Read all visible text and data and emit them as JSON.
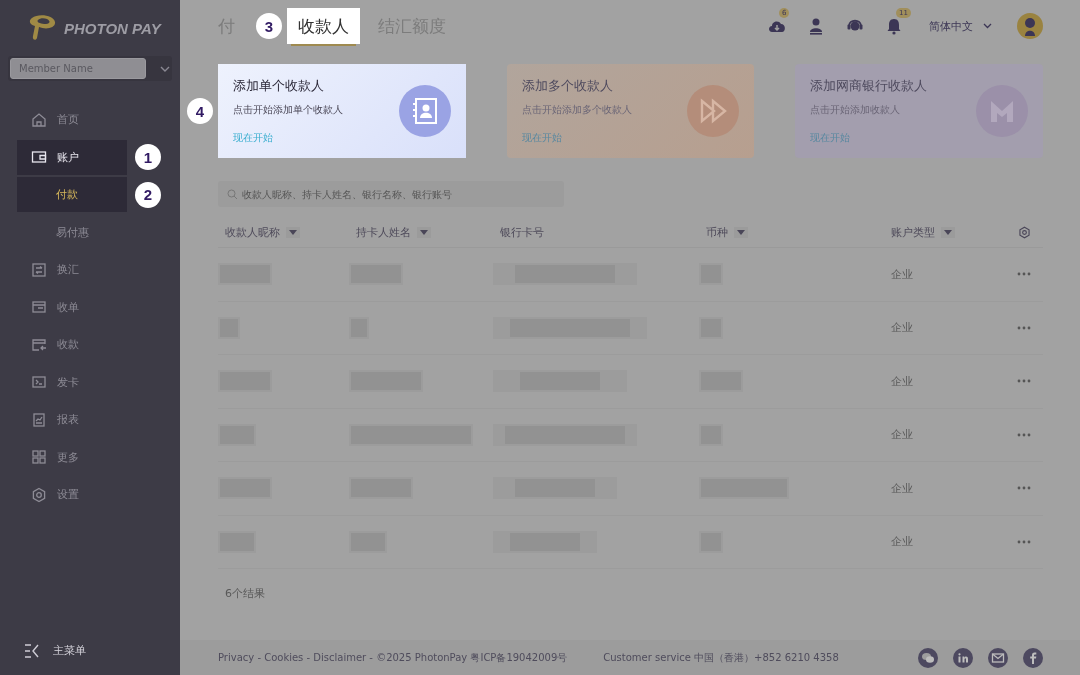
{
  "logo": {
    "text": "PHOTON PAY"
  },
  "member_select": {
    "placeholder": "Member Name"
  },
  "nav": [
    {
      "label": "首页",
      "kind": "home",
      "highlighted": false
    },
    {
      "label": "账户",
      "kind": "wallet",
      "highlighted": true,
      "callout": "1",
      "children": [
        {
          "label": "付款",
          "selected": true,
          "highlighted": true,
          "callout": "2"
        },
        {
          "label": "易付惠",
          "selected": false,
          "highlighted": false
        }
      ]
    },
    {
      "label": "换汇",
      "kind": "exchange",
      "highlighted": false
    },
    {
      "label": "收单",
      "kind": "acquiring",
      "highlighted": false
    },
    {
      "label": "收款",
      "kind": "receive",
      "highlighted": false
    },
    {
      "label": "发卡",
      "kind": "card",
      "highlighted": false
    },
    {
      "label": "报表",
      "kind": "report",
      "highlighted": false
    },
    {
      "label": "更多",
      "kind": "grid",
      "highlighted": false
    },
    {
      "label": "设置",
      "kind": "gear",
      "highlighted": false
    }
  ],
  "collapse_menu": {
    "label": "主菜单"
  },
  "tabs": [
    {
      "label": "付",
      "selected": false
    },
    {
      "label": "收款人",
      "selected": true,
      "callout": "3"
    },
    {
      "label": "结汇额度",
      "selected": false
    }
  ],
  "header": {
    "icons": [
      {
        "kind": "download",
        "badge": "6"
      },
      {
        "kind": "user"
      },
      {
        "kind": "support"
      },
      {
        "kind": "bell",
        "badge": "11"
      }
    ],
    "language": "简体中文"
  },
  "cards": [
    {
      "kind": "single",
      "title": "添加单个收款人",
      "description": "点击开始添加单个收款人",
      "link": "现在开始",
      "highlighted": true,
      "callout": "4"
    },
    {
      "kind": "bulk",
      "title": "添加多个收款人",
      "description": "点击开始添加多个收款人",
      "link": "现在开始",
      "highlighted": false
    },
    {
      "kind": "mybank",
      "title": "添加网商银行收款人",
      "description": "点击开始添加收款人",
      "link": "现在开始",
      "highlighted": false
    }
  ],
  "search": {
    "placeholder": "收款人昵称、持卡人姓名、银行名称、银行账号"
  },
  "table": {
    "columns": [
      {
        "label": "收款人昵称",
        "sortable": true
      },
      {
        "label": "持卡人姓名",
        "sortable": true
      },
      {
        "label": "银行卡号",
        "sortable": false
      },
      {
        "label": "币种",
        "sortable": true
      },
      {
        "label": "账户类型",
        "sortable": true
      }
    ],
    "rows": [
      {
        "account_type": "企业"
      },
      {
        "account_type": "企业"
      },
      {
        "account_type": "企业"
      },
      {
        "account_type": "企业"
      },
      {
        "account_type": "企业"
      },
      {
        "account_type": "企业"
      }
    ],
    "result_count": "6个结果"
  },
  "footer": {
    "legal": "Privacy - Cookies - Disclaimer - ©2025 PhotonPay 粤ICP备19042009号",
    "customer_service": "Customer service 中国（香港）+852 6210 4358",
    "social": [
      {
        "kind": "wechat"
      },
      {
        "kind": "linkedin"
      },
      {
        "kind": "mail"
      },
      {
        "kind": "facebook"
      }
    ]
  }
}
